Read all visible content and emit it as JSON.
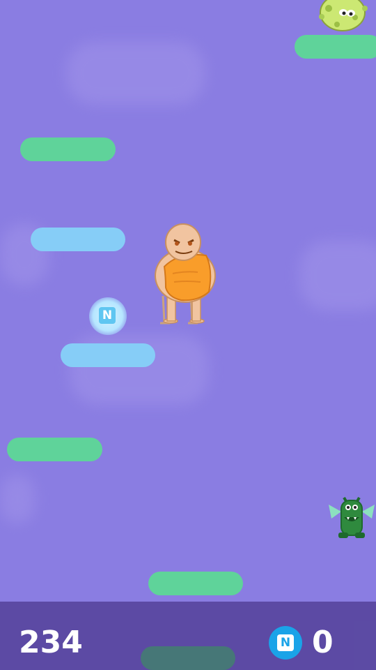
{
  "hud": {
    "score": "234",
    "coins": "0",
    "coin_symbol": "N"
  },
  "pickup": {
    "coin_symbol": "N"
  },
  "platforms": [
    {
      "type": "green",
      "color": "#5fd39a"
    },
    {
      "type": "green",
      "color": "#5fd39a"
    },
    {
      "type": "blue",
      "color": "#86cdf7"
    },
    {
      "type": "blue",
      "color": "#86cdf7"
    },
    {
      "type": "green",
      "color": "#5fd39a"
    },
    {
      "type": "green",
      "color": "#5fd39a"
    },
    {
      "type": "green-dim",
      "color": "#3d8a64"
    }
  ],
  "characters": {
    "player": "monk-character",
    "enemies": [
      "green-virus-monster",
      "green-winged-monster"
    ]
  },
  "colors": {
    "background": "#8a7de2",
    "hud": "#524096",
    "coin": "#1aa3e8"
  }
}
